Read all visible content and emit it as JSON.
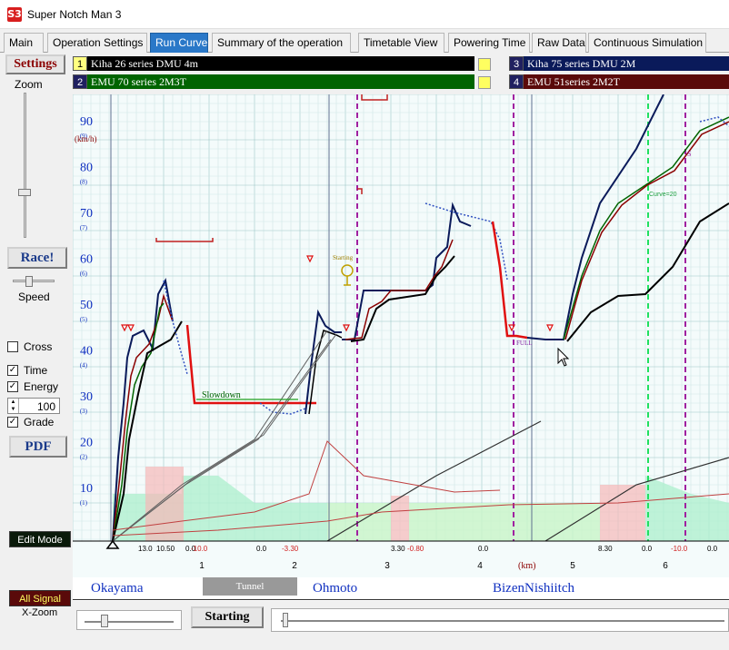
{
  "window": {
    "title": "Super Notch Man 3",
    "icon_text": "S3"
  },
  "tabs": [
    {
      "label": "Main",
      "active": false
    },
    {
      "label": "Operation Settings",
      "active": false
    },
    {
      "label": "Run Curve",
      "active": true
    },
    {
      "label": "Summary of the operation",
      "active": false
    },
    {
      "label": "Timetable View",
      "active": false
    },
    {
      "label": "Powering Time",
      "active": false
    },
    {
      "label": "Raw Data",
      "active": false
    },
    {
      "label": "Continuous Simulation",
      "active": false
    }
  ],
  "left": {
    "settings_label": "Settings",
    "zoom_label": "Zoom",
    "race_label": "Race!",
    "speed_label": "Speed",
    "cross_label": "Cross",
    "time_label": "Time",
    "energy_label": "Energy",
    "energy_value": "100",
    "grade_label": "Grade",
    "pdf_label": "PDF",
    "edit_mode_label": "Edit Mode",
    "all_signal_label": "All Signal",
    "xzoom_label": "X-Zoom",
    "cross_checked": false,
    "time_checked": true,
    "energy_checked": true,
    "grade_checked": true
  },
  "trains": [
    {
      "num": "1",
      "name": "Kiha 26 series DMU 4m",
      "color": "#000000",
      "num_bg": "#ffff80"
    },
    {
      "num": "2",
      "name": "EMU 70 series  2M3T",
      "color": "#006400",
      "num_bg": "#202060"
    },
    {
      "num": "3",
      "name": "Kiha 75 series DMU  2M",
      "color": "#0a1a5a",
      "num_bg": "#202060"
    },
    {
      "num": "4",
      "name": "EMU 51series  2M2T",
      "color": "#5a0a0a",
      "num_bg": "#202060"
    }
  ],
  "chart": {
    "y_ticks": [
      {
        "label": "90",
        "sub": "(9)"
      },
      {
        "label": "80",
        "sub": "(8)"
      },
      {
        "label": "70",
        "sub": "(7)"
      },
      {
        "label": "60",
        "sub": "(6)"
      },
      {
        "label": "50",
        "sub": "(5)"
      },
      {
        "label": "40",
        "sub": "(4)"
      },
      {
        "label": "30",
        "sub": "(3)"
      },
      {
        "label": "20",
        "sub": "(2)"
      },
      {
        "label": "10",
        "sub": "(1)"
      }
    ],
    "y_unit": "(km/h)",
    "x_ticks": [
      "1",
      "2",
      "3",
      "4",
      "5",
      "6"
    ],
    "x_unit": "(km)",
    "grade_labels": [
      "13.0",
      "10.50",
      "0.0",
      "-10.0",
      "0.0",
      "-3.30",
      "3.30",
      "-0.80",
      "0.0",
      "8.30",
      "0.0",
      "-10.0",
      "0.0"
    ],
    "annotations": {
      "slowdown": "Slowdown",
      "starting": "Starting",
      "full": "FULL",
      "curve": "Curve=20",
      "s_mark": "S"
    }
  },
  "stations": {
    "names": [
      "Okayama",
      "Ohmoto",
      "BizenNishiitch"
    ],
    "tunnel": "Tunnel"
  },
  "bottom": {
    "starting_button": "Starting"
  },
  "colors": {
    "accent": "#2a78c8",
    "axis_label": "#1030c0",
    "settings_text": "#8b0000",
    "pdf_text": "#1a3a8a"
  }
}
